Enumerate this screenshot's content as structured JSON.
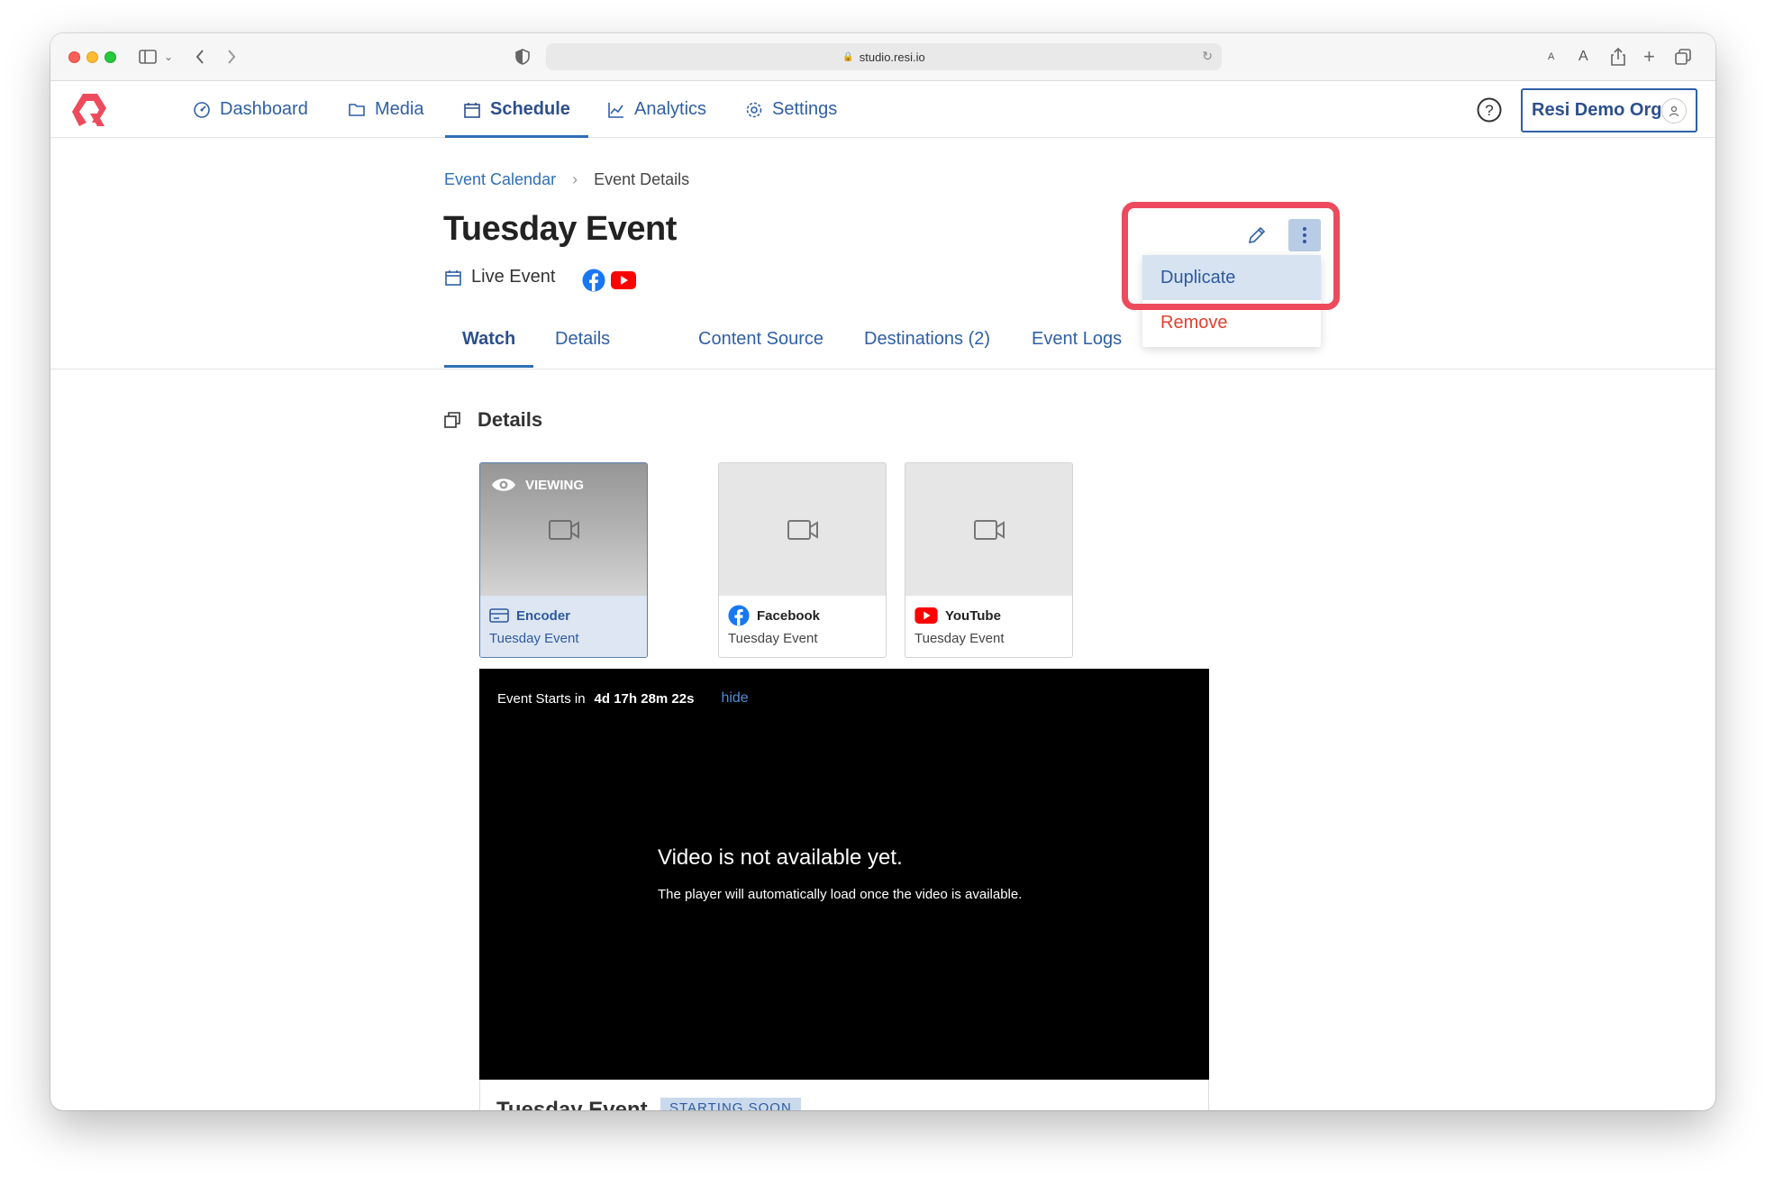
{
  "browser": {
    "url": "studio.resi.io"
  },
  "nav": {
    "items": [
      {
        "label": "Dashboard",
        "icon": "dashboard-icon",
        "active": false
      },
      {
        "label": "Media",
        "icon": "folder-icon",
        "active": false
      },
      {
        "label": "Schedule",
        "icon": "calendar-icon",
        "active": true
      },
      {
        "label": "Analytics",
        "icon": "chart-icon",
        "active": false
      },
      {
        "label": "Settings",
        "icon": "gear-icon",
        "active": false
      }
    ],
    "org_label": "Resi Demo Org"
  },
  "breadcrumb": {
    "parent": "Event Calendar",
    "current": "Event Details"
  },
  "event": {
    "title": "Tuesday Event",
    "type_label": "Live Event",
    "platforms": [
      "facebook-icon",
      "youtube-icon"
    ]
  },
  "tabs": [
    {
      "label": "Watch",
      "active": true
    },
    {
      "label": "Details",
      "active": false
    },
    {
      "label": "Content Source",
      "active": false
    },
    {
      "label": "Destinations (2)",
      "active": false
    },
    {
      "label": "Event Logs",
      "active": false
    }
  ],
  "actions_menu": {
    "items": [
      "Duplicate",
      "Remove"
    ]
  },
  "details": {
    "heading": "Details",
    "sources": [
      {
        "name": "Encoder",
        "subtitle": "Tuesday Event",
        "viewing": true,
        "badge": "VIEWING"
      },
      {
        "name": "Facebook",
        "subtitle": "Tuesday Event",
        "viewing": false
      },
      {
        "name": "YouTube",
        "subtitle": "Tuesday Event",
        "viewing": false
      }
    ]
  },
  "player": {
    "countdown_label": "Event Starts in",
    "countdown_value": "4d 17h 28m 22s",
    "hide_label": "hide",
    "unavailable_title": "Video is not available yet.",
    "unavailable_sub": "The player will automatically load once the video is available."
  },
  "below_player": {
    "title": "Tuesday Event",
    "status": "STARTING SOON"
  },
  "colors": {
    "accent": "#2f5fa6",
    "brand": "#ee4a5d",
    "remove": "#e2402f",
    "highlight": "#ee4a5d"
  }
}
